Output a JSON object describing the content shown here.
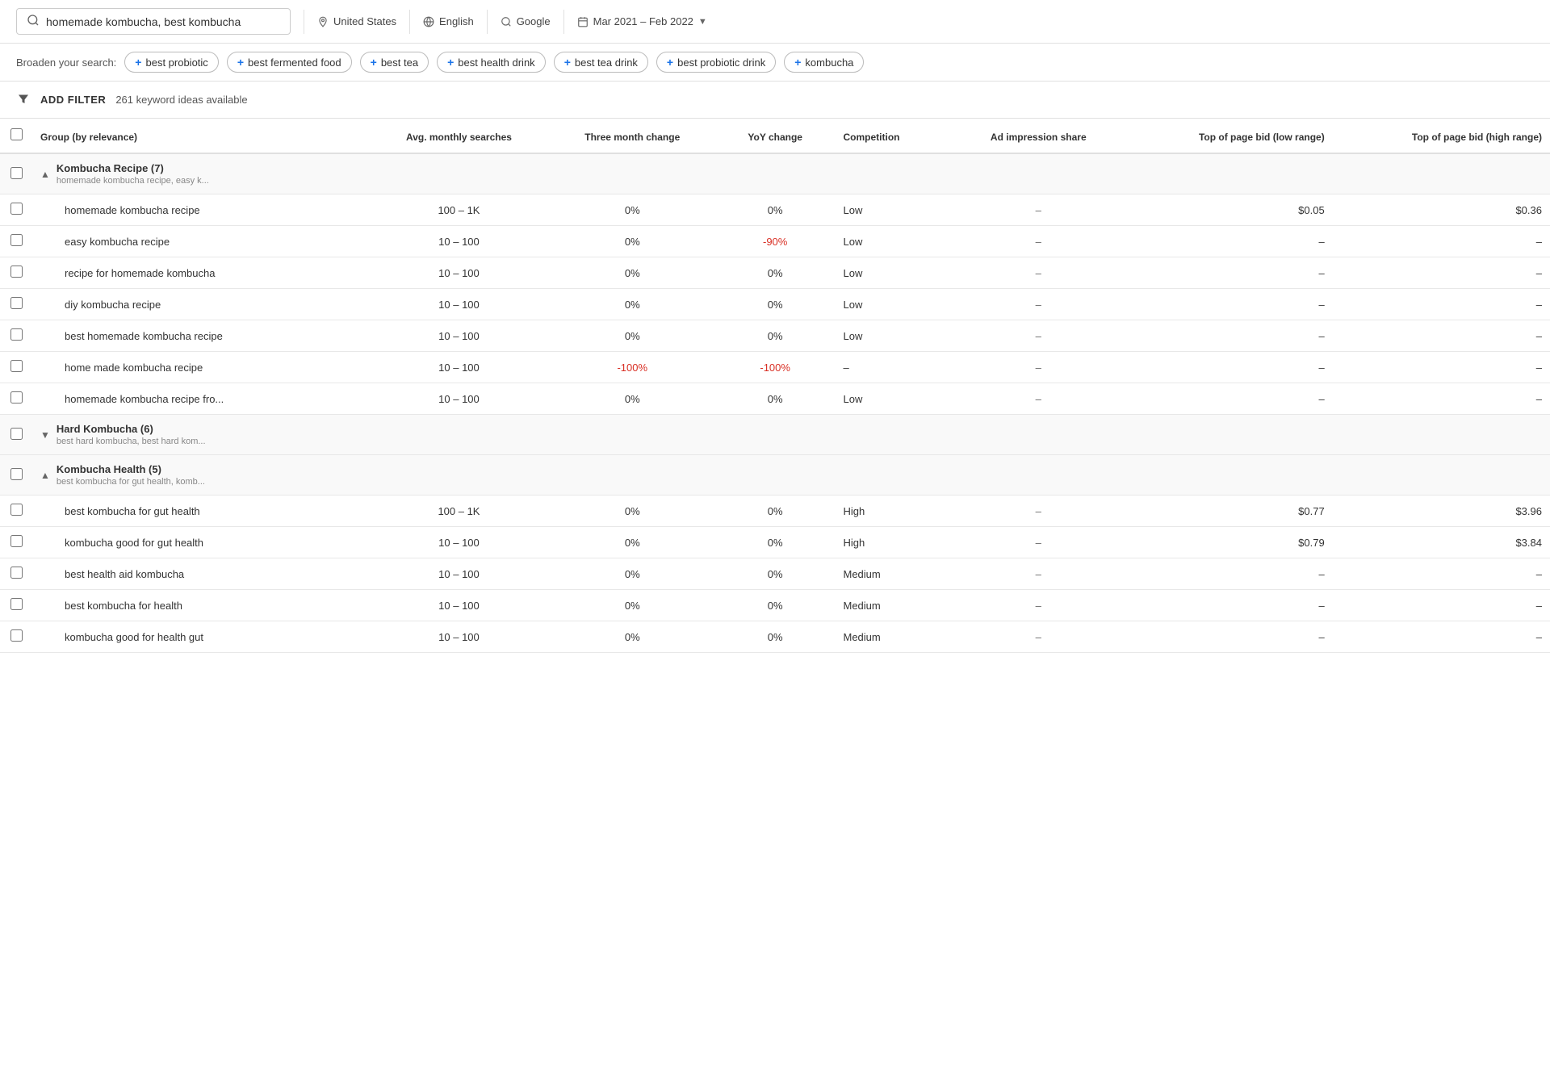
{
  "searchBar": {
    "query": "homemade kombucha, best kombucha",
    "location": "United States",
    "language": "English",
    "engine": "Google",
    "dateRange": "Mar 2021 – Feb 2022"
  },
  "broadenSearch": {
    "label": "Broaden your search:",
    "chips": [
      "best probiotic",
      "best fermented food",
      "best tea",
      "best health drink",
      "best tea drink",
      "best probiotic drink",
      "kombucha"
    ]
  },
  "filterBar": {
    "addFilterLabel": "ADD FILTER",
    "keywordCount": "261 keyword ideas available"
  },
  "table": {
    "headers": {
      "group": "Group (by relevance)",
      "avgMonthly": "Avg. monthly searches",
      "threeMonth": "Three month change",
      "yoy": "YoY change",
      "competition": "Competition",
      "adImpression": "Ad impression share",
      "bidLow": "Top of page bid (low range)",
      "bidHigh": "Top of page bid (high range)"
    },
    "rows": [
      {
        "type": "group",
        "name": "Kombucha Recipe (7)",
        "sub": "homemade kombucha recipe, easy k...",
        "expanded": true
      },
      {
        "type": "keyword",
        "keyword": "homemade kombucha recipe",
        "avg": "100 – 1K",
        "threeMonth": "0%",
        "yoy": "0%",
        "competition": "Low",
        "adImpression": "–",
        "bidLow": "$0.05",
        "bidHigh": "$0.36"
      },
      {
        "type": "keyword",
        "keyword": "easy kombucha recipe",
        "avg": "10 – 100",
        "threeMonth": "0%",
        "yoy": "-90%",
        "competition": "Low",
        "adImpression": "–",
        "bidLow": "–",
        "bidHigh": "–"
      },
      {
        "type": "keyword",
        "keyword": "recipe for homemade kombucha",
        "avg": "10 – 100",
        "threeMonth": "0%",
        "yoy": "0%",
        "competition": "Low",
        "adImpression": "–",
        "bidLow": "–",
        "bidHigh": "–"
      },
      {
        "type": "keyword",
        "keyword": "diy kombucha recipe",
        "avg": "10 – 100",
        "threeMonth": "0%",
        "yoy": "0%",
        "competition": "Low",
        "adImpression": "–",
        "bidLow": "–",
        "bidHigh": "–"
      },
      {
        "type": "keyword",
        "keyword": "best homemade kombucha recipe",
        "avg": "10 – 100",
        "threeMonth": "0%",
        "yoy": "0%",
        "competition": "Low",
        "adImpression": "–",
        "bidLow": "–",
        "bidHigh": "–"
      },
      {
        "type": "keyword",
        "keyword": "home made kombucha recipe",
        "avg": "10 – 100",
        "threeMonth": "-100%",
        "yoy": "-100%",
        "competition": "–",
        "adImpression": "–",
        "bidLow": "–",
        "bidHigh": "–"
      },
      {
        "type": "keyword",
        "keyword": "homemade kombucha recipe fro...",
        "avg": "10 – 100",
        "threeMonth": "0%",
        "yoy": "0%",
        "competition": "Low",
        "adImpression": "–",
        "bidLow": "–",
        "bidHigh": "–"
      },
      {
        "type": "group",
        "name": "Hard Kombucha (6)",
        "sub": "best hard kombucha, best hard kom...",
        "expanded": false
      },
      {
        "type": "group",
        "name": "Kombucha Health (5)",
        "sub": "best kombucha for gut health, komb...",
        "expanded": true
      },
      {
        "type": "keyword",
        "keyword": "best kombucha for gut health",
        "avg": "100 – 1K",
        "threeMonth": "0%",
        "yoy": "0%",
        "competition": "High",
        "adImpression": "–",
        "bidLow": "$0.77",
        "bidHigh": "$3.96"
      },
      {
        "type": "keyword",
        "keyword": "kombucha good for gut health",
        "avg": "10 – 100",
        "threeMonth": "0%",
        "yoy": "0%",
        "competition": "High",
        "adImpression": "–",
        "bidLow": "$0.79",
        "bidHigh": "$3.84"
      },
      {
        "type": "keyword",
        "keyword": "best health aid kombucha",
        "avg": "10 – 100",
        "threeMonth": "0%",
        "yoy": "0%",
        "competition": "Medium",
        "adImpression": "–",
        "bidLow": "–",
        "bidHigh": "–"
      },
      {
        "type": "keyword",
        "keyword": "best kombucha for health",
        "avg": "10 – 100",
        "threeMonth": "0%",
        "yoy": "0%",
        "competition": "Medium",
        "adImpression": "–",
        "bidLow": "–",
        "bidHigh": "–"
      },
      {
        "type": "keyword",
        "keyword": "kombucha good for health gut",
        "avg": "10 – 100",
        "threeMonth": "0%",
        "yoy": "0%",
        "competition": "Medium",
        "adImpression": "–",
        "bidLow": "–",
        "bidHigh": "–"
      }
    ]
  }
}
